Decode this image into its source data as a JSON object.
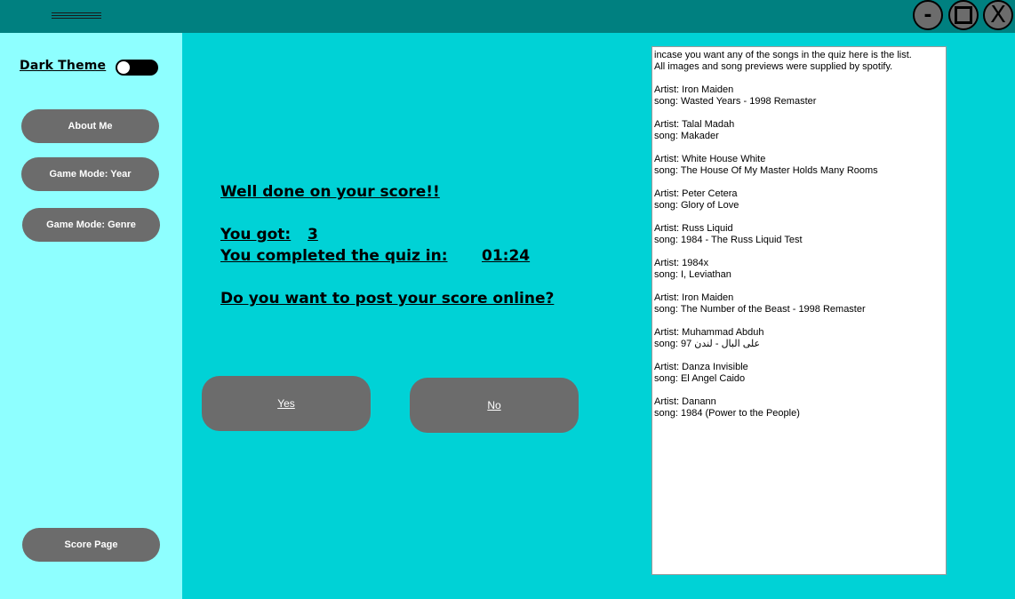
{
  "window": {
    "controls": {
      "minimize": "-",
      "close": "X"
    }
  },
  "sidebar": {
    "theme_label": "Dark Theme",
    "theme_toggle_on": false,
    "buttons": {
      "about": "About Me",
      "year": "Game Mode: Year",
      "genre": "Game Mode: Genre",
      "score": "Score Page"
    }
  },
  "main": {
    "well_done": "Well done on your score!!",
    "you_got_label": "You got:",
    "score": "3",
    "completed_label": "You completed the quiz in:",
    "time": "01:24",
    "post_question": "Do you want to post your score online?",
    "yes": "Yes",
    "no": "No"
  },
  "song_list": {
    "intro": [
      "incase you want any of the songs in the quiz here is the list.",
      "All images and song previews were supplied by spotify."
    ],
    "entries": [
      {
        "artist": "Artist: Iron Maiden",
        "song": "song: Wasted Years - 1998 Remaster"
      },
      {
        "artist": "Artist: Talal Madah",
        "song": "song: Makader"
      },
      {
        "artist": "Artist: White House White",
        "song": "song: The House Of My Master Holds Many Rooms"
      },
      {
        "artist": "Artist: Peter Cetera",
        "song": "song: Glory of Love"
      },
      {
        "artist": "Artist: Russ Liquid",
        "song": "song: 1984 - The Russ Liquid Test"
      },
      {
        "artist": "Artist: 1984x",
        "song": "song: I, Leviathan"
      },
      {
        "artist": "Artist: Iron Maiden",
        "song": "song: The Number of the Beast - 1998 Remaster"
      },
      {
        "artist": "Artist: Muhammad Abduh",
        "song": "song: 97 على البال - لندن"
      },
      {
        "artist": "Artist: Danza Invisible",
        "song": "song: El Angel Caido"
      },
      {
        "artist": "Artist: Danann",
        "song": "song: 1984 (Power to the People)"
      }
    ]
  }
}
